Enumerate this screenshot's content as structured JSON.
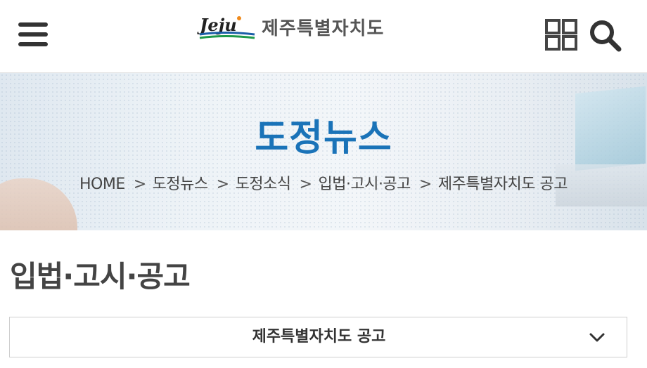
{
  "header": {
    "logo_text": "제주특별자치도",
    "logo_script": "Jeju"
  },
  "banner": {
    "title": "도정뉴스",
    "breadcrumb": [
      "HOME",
      "도정뉴스",
      "도정소식",
      "입법·고시·공고",
      "제주특별자치도 공고"
    ]
  },
  "page": {
    "title": "입법·고시·공고"
  },
  "select": {
    "selected": "제주특별자치도 공고"
  },
  "colors": {
    "accent": "#1a73b8",
    "icon": "#333333",
    "logo_green": "#1e9a4a",
    "logo_blue": "#1a5ea8",
    "logo_orange": "#f08a1c"
  },
  "icons": {
    "menu": "hamburger-icon",
    "grid": "grid-icon",
    "search": "search-icon",
    "select": "chevron-down-icon"
  }
}
